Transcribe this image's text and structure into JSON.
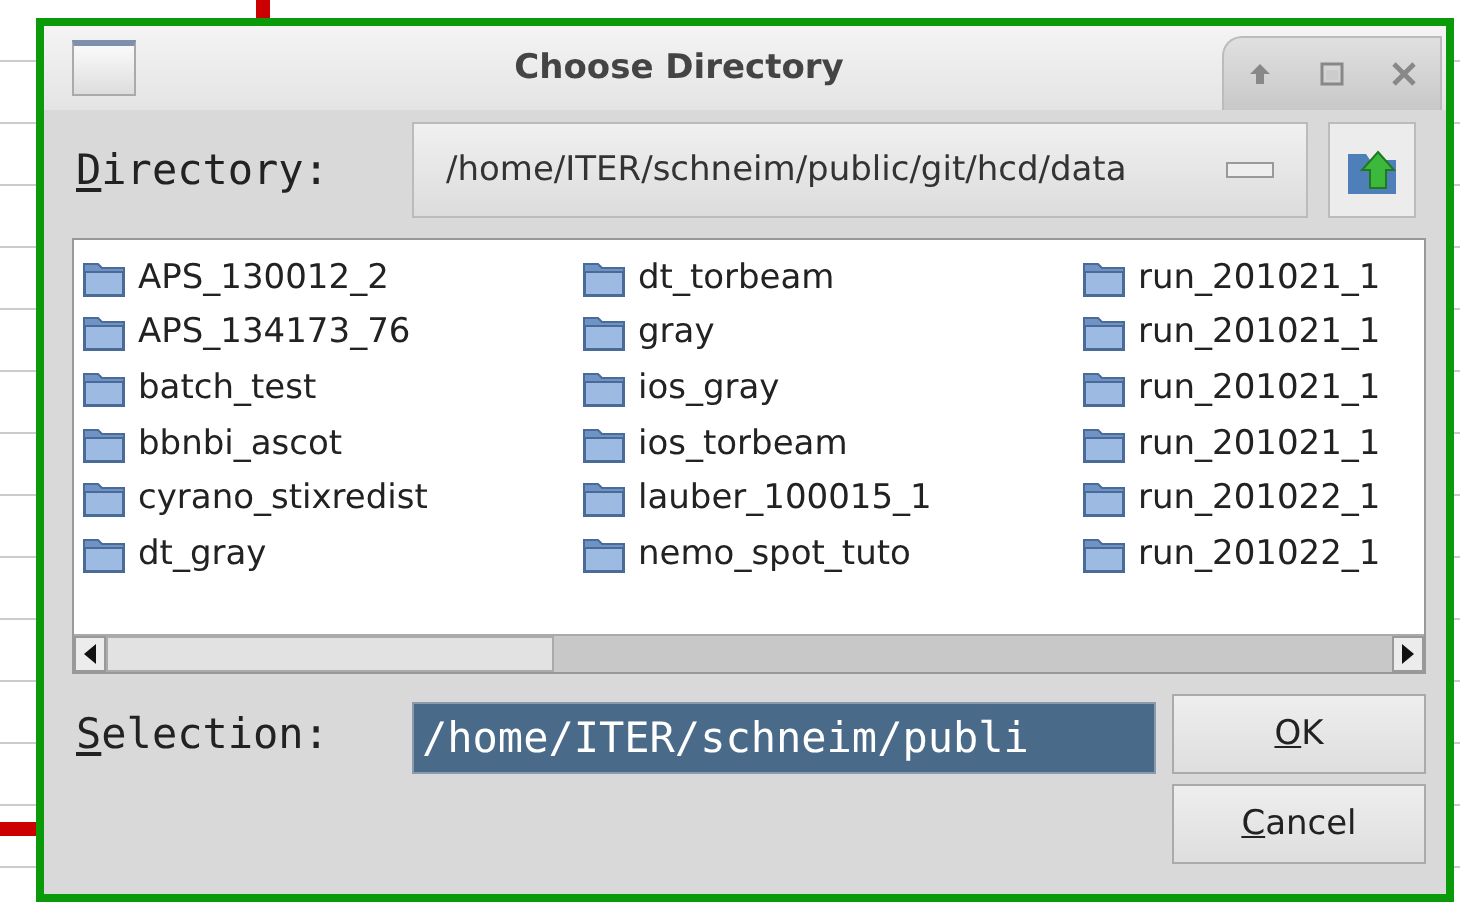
{
  "window": {
    "title": "Choose Directory"
  },
  "directory": {
    "label": "Directory:",
    "access_key_underlined": true,
    "value": "/home/ITER/schneim/public/git/hcd/data"
  },
  "folders": [
    [
      "APS_130012_2",
      "APS_134173_76",
      "batch_test",
      "bbnbi_ascot",
      "cyrano_stixredist",
      "dt_gray"
    ],
    [
      "dt_torbeam",
      "gray",
      "ios_gray",
      "ios_torbeam",
      "lauber_100015_1",
      "nemo_spot_tuto"
    ],
    [
      "run_201021_1",
      "run_201021_1",
      "run_201021_1",
      "run_201021_1",
      "run_201022_1",
      "run_201022_1"
    ]
  ],
  "selection": {
    "label": "Selection:",
    "access_key_underlined": true,
    "value": "/home/ITER/schneim/publi",
    "selected": true
  },
  "buttons": [
    {
      "label": "OK",
      "access_key_underlined": true
    },
    {
      "label": "Cancel",
      "access_key_underlined": true
    }
  ]
}
